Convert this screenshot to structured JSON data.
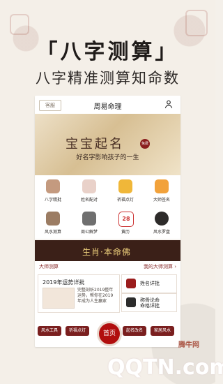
{
  "promo": {
    "title": "「八字测算」",
    "subtitle": "八字精准测算知命数"
  },
  "app": {
    "kefu_label": "客服",
    "title": "周易命理",
    "banner_title": "宝宝起名",
    "banner_tag": "免费",
    "banner_subtitle": "好名字影响孩子的一生"
  },
  "grid": [
    {
      "label": "八字精批",
      "icon": "bazi-icon"
    },
    {
      "label": "姓名配对",
      "icon": "name-pair-icon"
    },
    {
      "label": "祈福点灯",
      "icon": "lamp-icon"
    },
    {
      "label": "大师签名",
      "icon": "signature-icon"
    },
    {
      "label": "风水测算",
      "icon": "fengshui-icon"
    },
    {
      "label": "周公解梦",
      "icon": "dream-icon"
    },
    {
      "label": "黄历",
      "icon": "calendar-icon",
      "calendar_number": "28"
    },
    {
      "label": "风水罗盘",
      "icon": "compass-icon"
    }
  ],
  "lifebar": {
    "text": "生肖·本命佛"
  },
  "master": {
    "left": "大师测算",
    "right": "我的大师测算 ›",
    "card_main_title": "2019年运势详批",
    "card_main_desc": "完整剖析2019整年运势，帮你在2019年成为人生赢家",
    "side1_title": "姓名详批",
    "side2_title": "称骨论命\n命格详批"
  },
  "nav": {
    "btn1": "风水工具",
    "btn2": "祈福点灯",
    "home": "首页",
    "btn3": "起名改名",
    "btn4": "家居风水"
  },
  "watermark": {
    "logo": "QQTN.com",
    "small": "腾牛网"
  }
}
